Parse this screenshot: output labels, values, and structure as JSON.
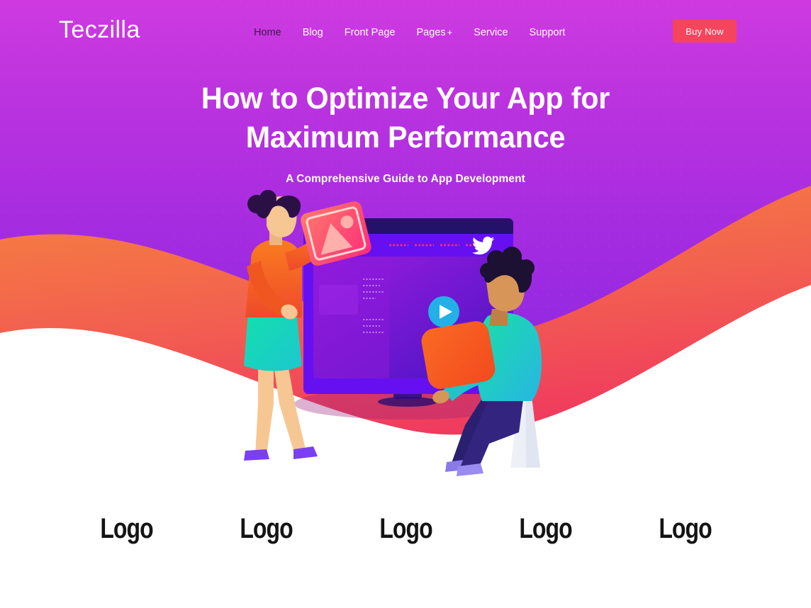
{
  "header": {
    "logo": "Teczilla",
    "nav": [
      {
        "label": "Home",
        "active": true
      },
      {
        "label": "Blog",
        "active": false
      },
      {
        "label": "Front Page",
        "active": false
      },
      {
        "label": "Pages",
        "active": false,
        "caret": "+"
      },
      {
        "label": "Service",
        "active": false
      },
      {
        "label": "Support",
        "active": false
      }
    ],
    "cta_label": "Buy Now",
    "cta_color": "#f4455c"
  },
  "hero": {
    "title_line1": "How to Optimize Your App for",
    "title_line2": "Maximum Performance",
    "subtitle": "A Comprehensive Guide to App Development"
  },
  "illustration": {
    "browser": {
      "titlebar_dots": 3,
      "search_pill_color": "#19e6b0",
      "nav_dash_count": 4,
      "nav_dash_color": "#ff2e63",
      "social_icon": "twitter-icon",
      "play_button_color": "#29b6e8"
    },
    "characters": [
      {
        "name": "woman-standing",
        "hair": "#2b1046",
        "top": "#f26722",
        "skirt": "#18d6ad",
        "shoes": "#7b3ff2",
        "card": "#ff3d6e"
      },
      {
        "name": "man-sitting",
        "hair": "#1c1033",
        "top": "#19c9c4",
        "pants": "#2b2070",
        "shoes": "#8a7ae8",
        "card": "#f4581c"
      }
    ]
  },
  "partners": {
    "items": [
      {
        "label": "Logo"
      },
      {
        "label": "Logo"
      },
      {
        "label": "Logo"
      },
      {
        "label": "Logo"
      },
      {
        "label": "Logo"
      }
    ]
  },
  "theme": {
    "bg_top": "#cf3ae0",
    "bg_bottom": "#8a26e3",
    "wave_start": "#f7823f",
    "wave_end": "#f0325f",
    "white": "#ffffff"
  }
}
